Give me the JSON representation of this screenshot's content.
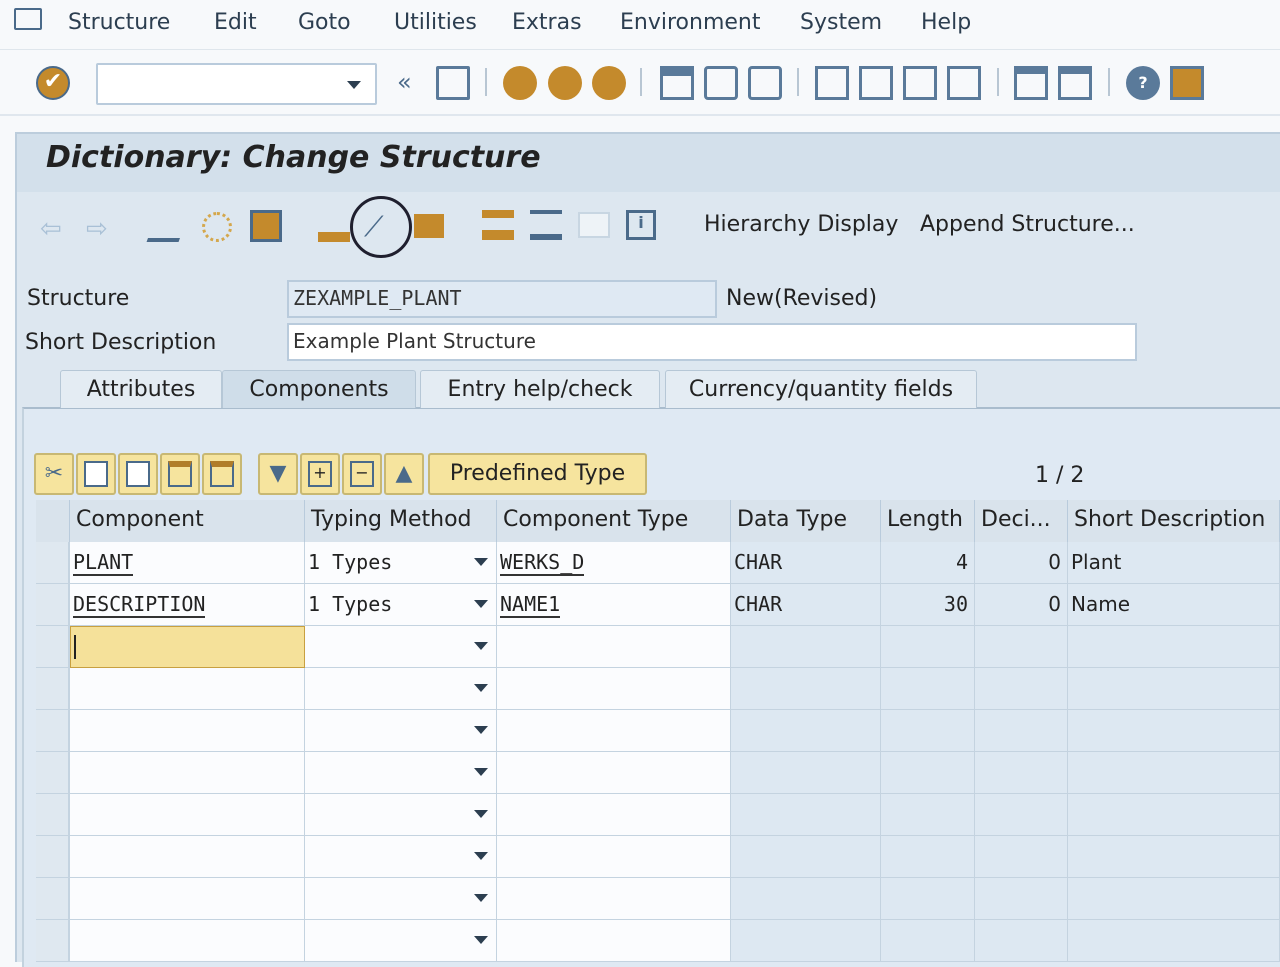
{
  "menu": {
    "items": [
      "Structure",
      "Edit",
      "Goto",
      "Utilities",
      "Extras",
      "Environment",
      "System",
      "Help"
    ]
  },
  "toolbar": {
    "command_value": "",
    "icons": [
      "enter-icon",
      "save-icon",
      "back-icon",
      "exit-icon",
      "cancel-icon",
      "print-icon",
      "find-icon",
      "find-next-icon",
      "first-page-icon",
      "prev-page-icon",
      "next-page-icon",
      "last-page-icon",
      "new-session-icon",
      "shortcut-icon",
      "help-icon",
      "customize-icon"
    ]
  },
  "screen": {
    "title": "Dictionary: Change Structure"
  },
  "app_toolbar": {
    "hierarchy_display": "Hierarchy Display",
    "append_structure": "Append Structure...",
    "highlighted_icon": "magic-wand-icon"
  },
  "form": {
    "structure_label": "Structure",
    "structure_value": "ZEXAMPLE_PLANT",
    "status": "New(Revised)",
    "short_desc_label": "Short Description",
    "short_desc_value": "Example Plant Structure"
  },
  "tabs": [
    {
      "label": "Attributes"
    },
    {
      "label": "Components",
      "active": true
    },
    {
      "label": "Entry help/check"
    },
    {
      "label": "Currency/quantity fields"
    }
  ],
  "table_toolbar": {
    "predefined_type": "Predefined Type",
    "pager": "1 / 2"
  },
  "table": {
    "columns": [
      "Component",
      "Typing Method",
      "Component Type",
      "Data Type",
      "Length",
      "Deci...",
      "Short Description"
    ],
    "rows": [
      {
        "component": "PLANT",
        "typing": "1 Types",
        "ctype": "WERKS_D",
        "dtype": "CHAR",
        "length": "4",
        "dec": "0",
        "desc": "Plant"
      },
      {
        "component": "DESCRIPTION",
        "typing": "1 Types",
        "ctype": "NAME1",
        "dtype": "CHAR",
        "length": "30",
        "dec": "0",
        "desc": "Name"
      },
      {
        "component": "",
        "typing": "",
        "ctype": "",
        "dtype": "",
        "length": "",
        "dec": "",
        "desc": ""
      },
      {
        "component": "",
        "typing": "",
        "ctype": "",
        "dtype": "",
        "length": "",
        "dec": "",
        "desc": ""
      },
      {
        "component": "",
        "typing": "",
        "ctype": "",
        "dtype": "",
        "length": "",
        "dec": "",
        "desc": ""
      },
      {
        "component": "",
        "typing": "",
        "ctype": "",
        "dtype": "",
        "length": "",
        "dec": "",
        "desc": ""
      },
      {
        "component": "",
        "typing": "",
        "ctype": "",
        "dtype": "",
        "length": "",
        "dec": "",
        "desc": ""
      },
      {
        "component": "",
        "typing": "",
        "ctype": "",
        "dtype": "",
        "length": "",
        "dec": "",
        "desc": ""
      },
      {
        "component": "",
        "typing": "",
        "ctype": "",
        "dtype": "",
        "length": "",
        "dec": "",
        "desc": ""
      },
      {
        "component": "",
        "typing": "",
        "ctype": "",
        "dtype": "",
        "length": "",
        "dec": "",
        "desc": ""
      }
    ]
  },
  "colors": {
    "accent": "#c48a2c",
    "button_yellow": "#f6e49e",
    "panel": "#dde7f0",
    "focus_cell": "#f5e19a"
  }
}
